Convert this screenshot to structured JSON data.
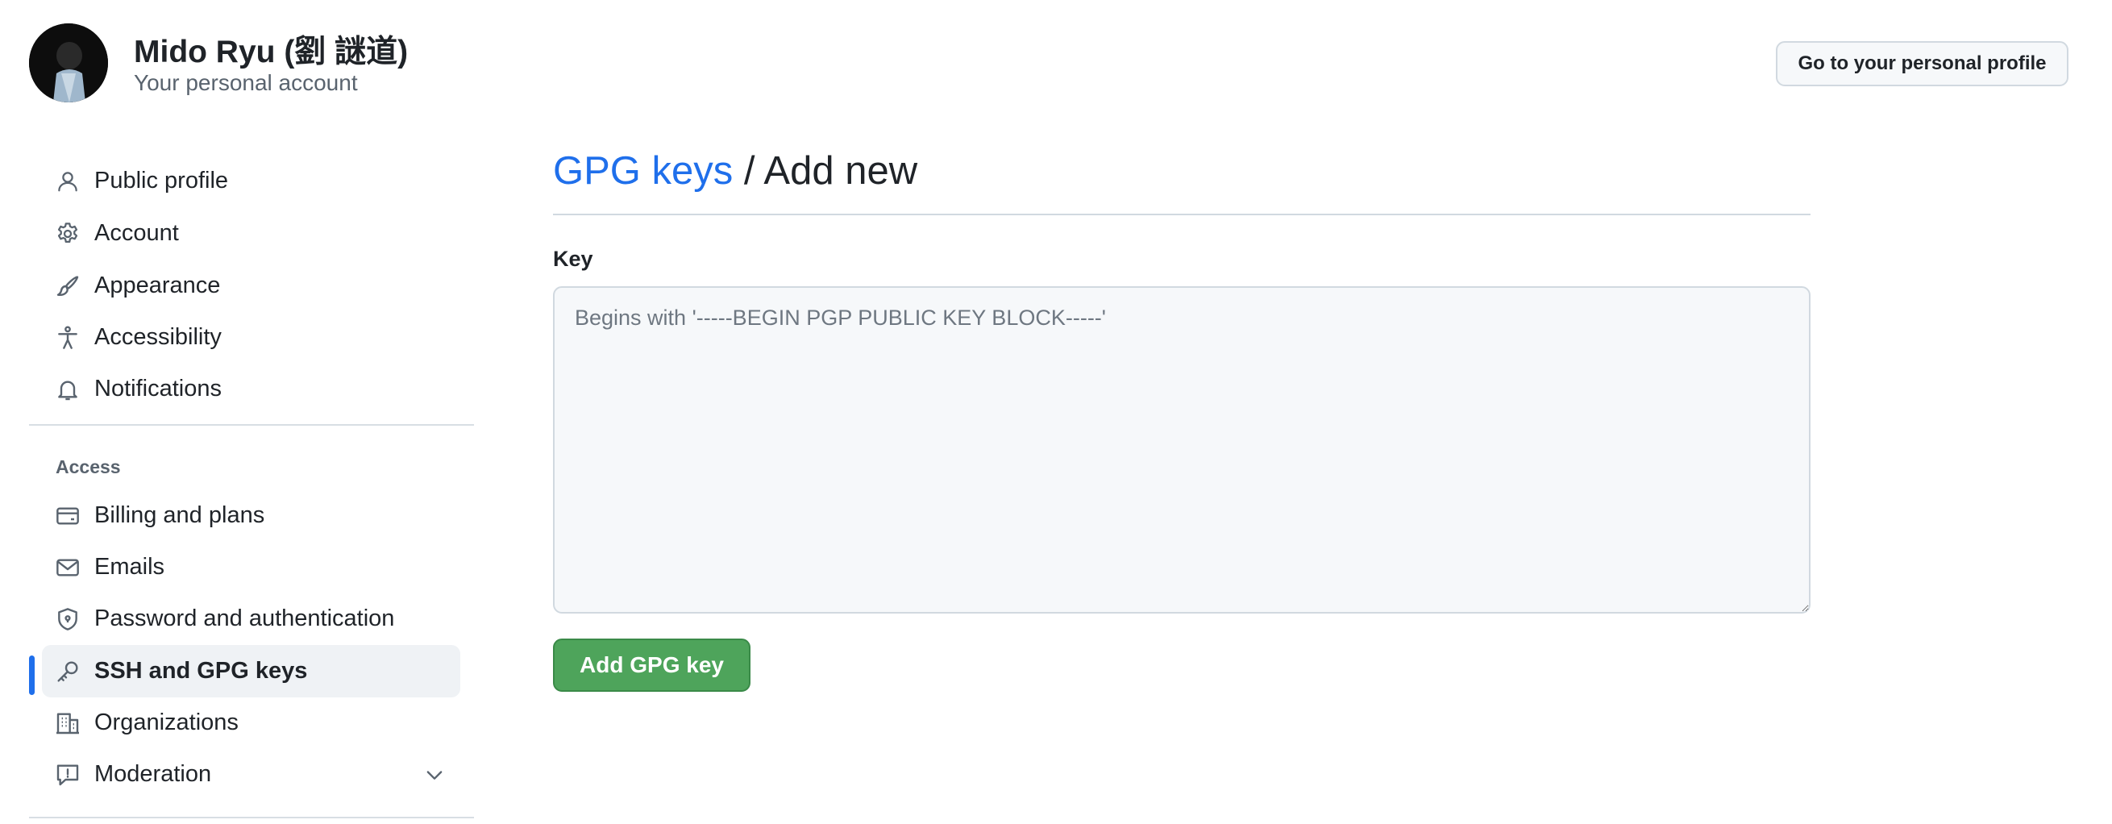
{
  "account": {
    "name": "Mido Ryu (劉 謎道)",
    "subtitle": "Your personal account",
    "profile_button": "Go to your personal profile"
  },
  "sidebar": {
    "items": [
      {
        "label": "Public profile",
        "icon": "person-icon"
      },
      {
        "label": "Account",
        "icon": "gear-icon"
      },
      {
        "label": "Appearance",
        "icon": "paintbrush-icon"
      },
      {
        "label": "Accessibility",
        "icon": "accessibility-icon"
      },
      {
        "label": "Notifications",
        "icon": "bell-icon"
      }
    ],
    "access_section": {
      "label": "Access",
      "items": [
        {
          "label": "Billing and plans",
          "icon": "credit-card-icon"
        },
        {
          "label": "Emails",
          "icon": "mail-icon"
        },
        {
          "label": "Password and authentication",
          "icon": "shield-lock-icon"
        },
        {
          "label": "SSH and GPG keys",
          "icon": "key-icon",
          "active": true
        },
        {
          "label": "Organizations",
          "icon": "organization-icon"
        },
        {
          "label": "Moderation",
          "icon": "report-icon",
          "expandable": true
        }
      ]
    }
  },
  "main": {
    "breadcrumb_link": "GPG keys",
    "breadcrumb_separator": " / ",
    "breadcrumb_current": "Add new",
    "key_label": "Key",
    "key_placeholder": "Begins with '-----BEGIN PGP PUBLIC KEY BLOCK-----'",
    "submit_label": "Add GPG key"
  },
  "colors": {
    "accent": "#1f6feb",
    "primary_button": "#4ea45b",
    "active_nav_bg": "#eff2f5"
  }
}
